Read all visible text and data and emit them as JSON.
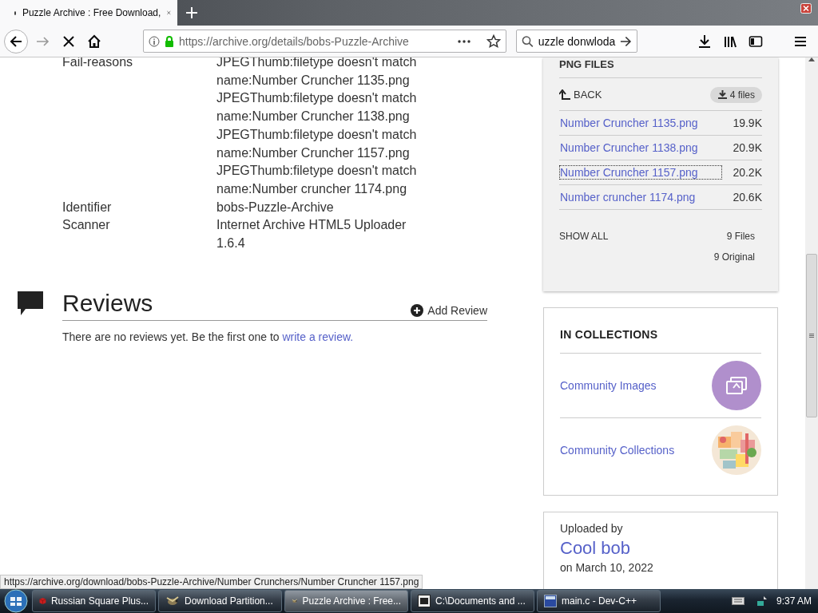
{
  "browser": {
    "tab_title": "Puzzle Archive : Free Download,",
    "address": "https://archive.org/details/bobs-Puzzle-Archive",
    "search_value": "uzzle donwloda"
  },
  "metadata": [
    {
      "label": "Fail-reasons",
      "values": [
        "JPEGThumb:filetype doesn't match name:Number Cruncher 1135.png",
        "JPEGThumb:filetype doesn't match name:Number Cruncher 1138.png",
        "JPEGThumb:filetype doesn't match name:Number Cruncher 1157.png",
        "JPEGThumb:filetype doesn't match name:Number cruncher 1174.png"
      ]
    },
    {
      "label": "Identifier",
      "values": [
        "bobs-Puzzle-Archive"
      ]
    },
    {
      "label": "Scanner",
      "values": [
        "Internet Archive HTML5 Uploader 1.6.4"
      ]
    }
  ],
  "reviews": {
    "title": "Reviews",
    "add_button": "Add Review",
    "empty_text": "There are no reviews yet. Be the first one to",
    "link": "write a review."
  },
  "files_panel": {
    "title": "PNG FILES",
    "back": "BACK",
    "download": "4 files",
    "files": [
      {
        "name": "Number Cruncher 1135.png",
        "size": "19.9K",
        "focused": false
      },
      {
        "name": "Number Cruncher 1138.png",
        "size": "20.9K",
        "focused": false
      },
      {
        "name": "Number Cruncher 1157.png",
        "size": "20.2K",
        "focused": true
      },
      {
        "name": "Number cruncher 1174.png",
        "size": "20.6K",
        "focused": false
      }
    ],
    "show_all": "SHOW ALL",
    "file_count": "9 Files",
    "original_count": "9 Original"
  },
  "collections": {
    "title": "IN COLLECTIONS",
    "items": [
      {
        "name": "Community Images",
        "kind": "images"
      },
      {
        "name": "Community Collections",
        "kind": "mosaic"
      }
    ]
  },
  "uploader": {
    "label": "Uploaded by",
    "name": "Cool bob",
    "date": "on March 10, 2022"
  },
  "status_url": "https://archive.org/download/bobs-Puzzle-Archive/Number Crunchers/Number Cruncher 1157.png",
  "taskbar": {
    "items": [
      {
        "label": "Russian Square Plus...",
        "kind": "cube",
        "selected": false
      },
      {
        "label": "Download Partition...",
        "kind": "bird",
        "selected": false
      },
      {
        "label": "Puzzle Archive : Free...",
        "kind": "bird",
        "selected": true
      },
      {
        "label": "C:\\Documents and ...",
        "kind": "archive",
        "selected": false
      },
      {
        "label": "main.c - Dev-C++",
        "kind": "ide",
        "selected": false
      }
    ],
    "time": "9:37 AM"
  }
}
